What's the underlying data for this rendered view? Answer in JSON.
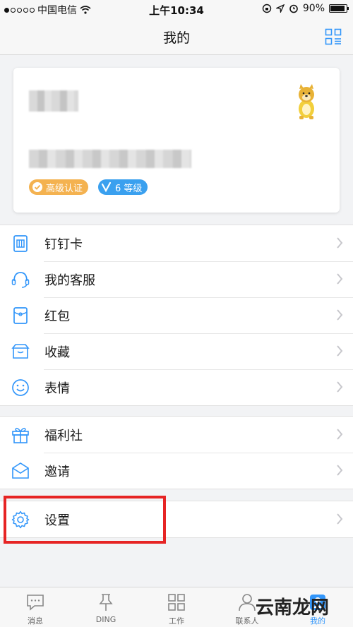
{
  "status_bar": {
    "carrier": "中国电信",
    "time": "上午10:34",
    "battery": "90%",
    "battery_level": 0.9
  },
  "nav": {
    "title": "我的"
  },
  "profile": {
    "badges": [
      {
        "label": "高级认证",
        "icon": "verified-check-icon"
      },
      {
        "label": "6 等级",
        "icon": "v-level-icon"
      }
    ]
  },
  "menu_group_1": [
    {
      "label": "钉钉卡",
      "icon": "card-icon"
    },
    {
      "label": "我的客服",
      "icon": "headset-icon"
    },
    {
      "label": "红包",
      "icon": "red-envelope-icon"
    },
    {
      "label": "收藏",
      "icon": "favorites-box-icon"
    },
    {
      "label": "表情",
      "icon": "smiley-icon"
    }
  ],
  "menu_group_2": [
    {
      "label": "福利社",
      "icon": "gift-icon"
    },
    {
      "label": "邀请",
      "icon": "envelope-icon"
    }
  ],
  "menu_group_3": [
    {
      "label": "设置",
      "icon": "gear-icon"
    }
  ],
  "tabs": [
    {
      "label": "消息",
      "icon": "message-icon"
    },
    {
      "label": "DING",
      "icon": "pin-icon"
    },
    {
      "label": "工作",
      "icon": "grid-icon"
    },
    {
      "label": "联系人",
      "icon": "contacts-icon"
    },
    {
      "label": "我的",
      "icon": "me-icon",
      "active": true
    }
  ],
  "watermark": "云南龙网",
  "colors": {
    "accent": "#3296fa",
    "highlight": "#e62424",
    "cert_badge": "#f4b250",
    "level_badge": "#3aa0ef"
  }
}
